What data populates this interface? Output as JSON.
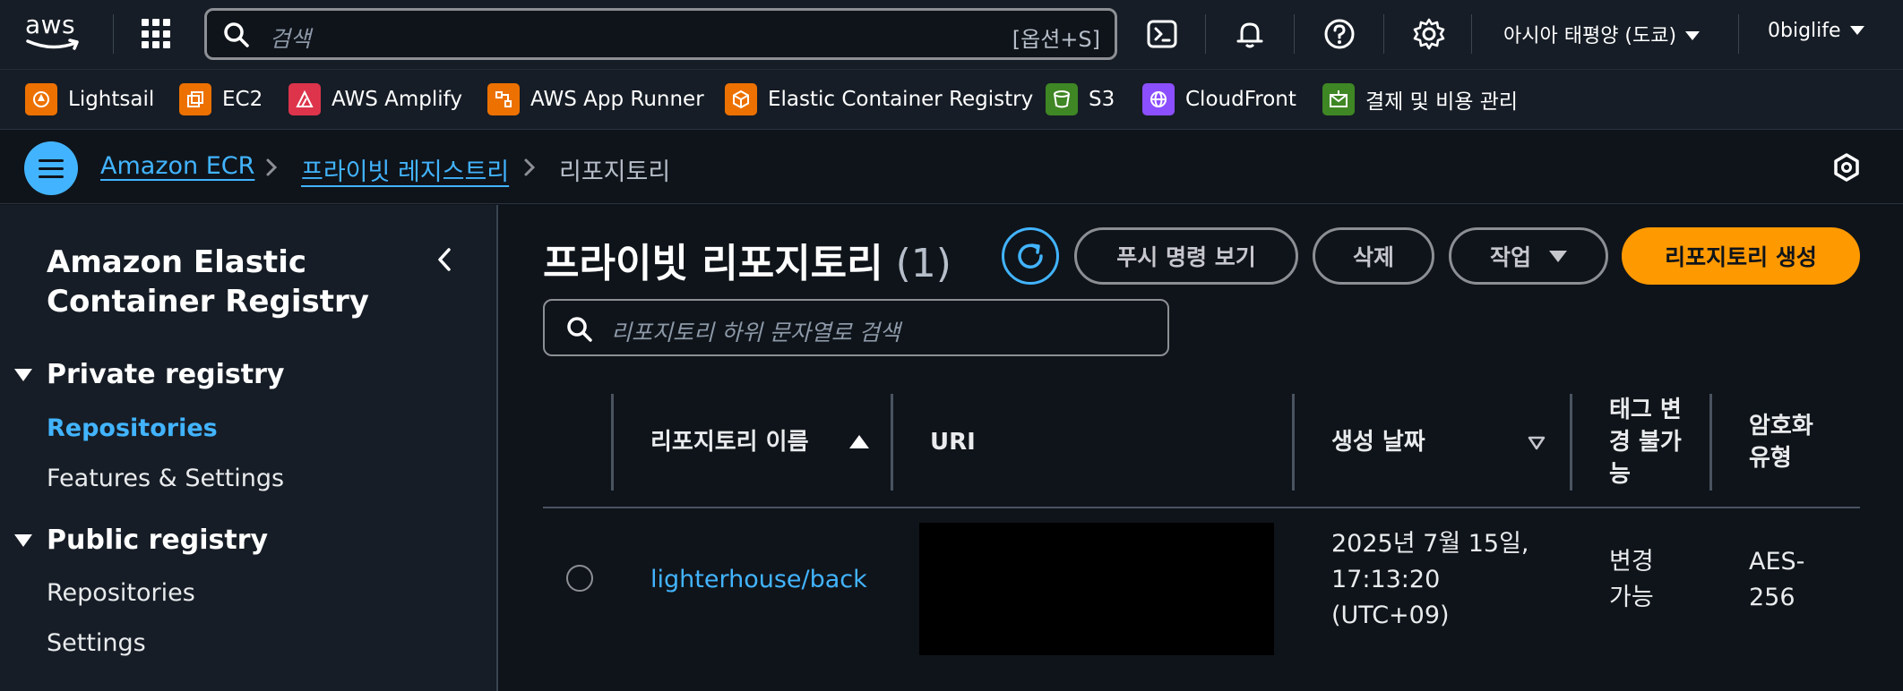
{
  "topnav": {
    "logo_text": "aws",
    "search_placeholder": "검색",
    "search_shortcut": "[옵션+S]",
    "region": "아시아 태평양 (도쿄)",
    "account": "0biglife"
  },
  "favorites": [
    {
      "label": "Lightsail",
      "color": "#ed7100"
    },
    {
      "label": "EC2",
      "color": "#ed7100"
    },
    {
      "label": "AWS Amplify",
      "color": "#dd344c"
    },
    {
      "label": "AWS App Runner",
      "color": "#ed7100"
    },
    {
      "label": "Elastic Container Registry",
      "color": "#ed7100"
    },
    {
      "label": "S3",
      "color": "#3f8624"
    },
    {
      "label": "CloudFront",
      "color": "#8c4fff"
    },
    {
      "label": "결제 및 비용 관리",
      "color": "#3f8624"
    }
  ],
  "breadcrumb": {
    "items": [
      "Amazon ECR",
      "프라이빗 레지스트리",
      "리포지토리"
    ]
  },
  "sidebar": {
    "title": "Amazon Elastic Container Registry",
    "private_heading": "Private registry",
    "private_items": [
      "Repositories",
      "Features & Settings"
    ],
    "public_heading": "Public registry",
    "public_items": [
      "Repositories",
      "Settings"
    ]
  },
  "main": {
    "title": "프라이빗 리포지토리",
    "count": "(1)",
    "buttons": {
      "push": "푸시 명령 보기",
      "delete": "삭제",
      "actions": "작업",
      "create": "리포지토리 생성"
    },
    "filter_placeholder": "리포지토리 하위 문자열로 검색",
    "columns": [
      "리포지토리 이름",
      "URI",
      "생성 날짜",
      "태그 변경 불가능",
      "암호화 유형"
    ],
    "rows": [
      {
        "name": "lighterhouse/back",
        "uri": "",
        "created": "2025년 7월 15일, 17:13:20 (UTC+09)",
        "immutability": "변경 가능",
        "encryption": "AES-256"
      }
    ]
  },
  "colors": {
    "accent": "#42b4ff",
    "primary_button": "#ff9900",
    "background": "#0f141a",
    "panel": "#161d26"
  }
}
